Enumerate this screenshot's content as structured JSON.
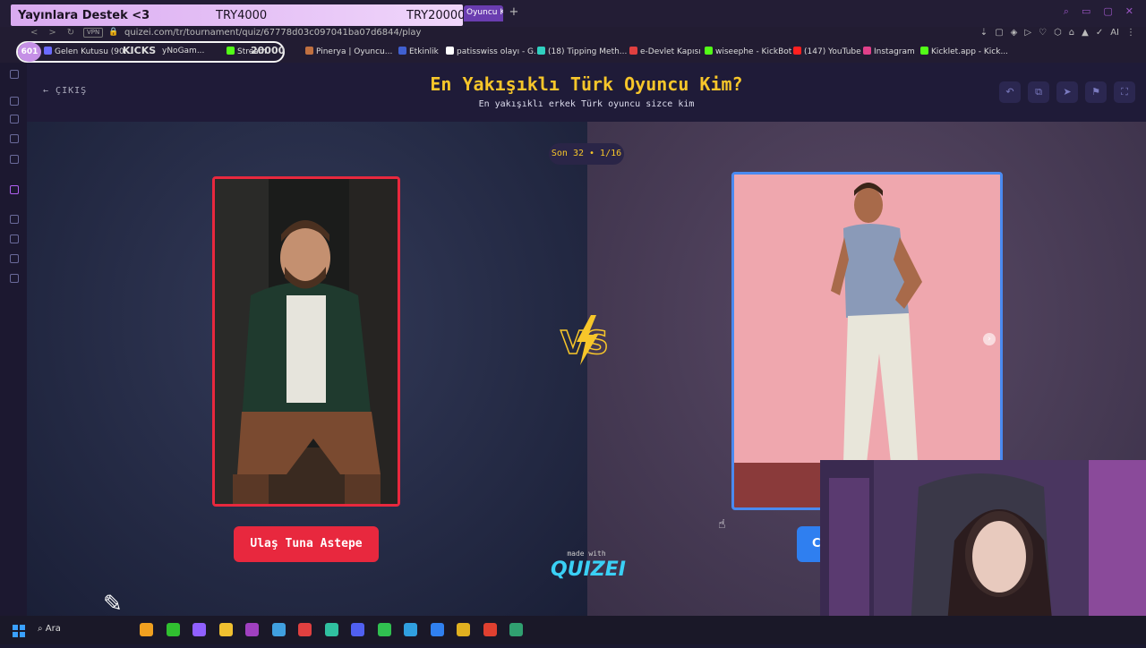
{
  "overlay": {
    "left": "Yayınlara Destek <3",
    "mid": "TRY4000",
    "right": "TRY20000"
  },
  "browser": {
    "active_tab": "Oyuncu K",
    "new_tab": "+",
    "window_controls": [
      "⌕",
      "▭",
      "▢",
      "✕"
    ],
    "url": "quizei.com/tr/tournament/quiz/67778d03c097041ba07d6844/play",
    "vpn": "VPN",
    "lock": "🔒",
    "nav": [
      "<",
      ">",
      "↻"
    ],
    "extensions": [
      "⇣",
      "▢",
      "◈",
      "▷",
      "♡",
      "⬡",
      "⌂",
      "▲",
      "✓",
      "AI",
      "⋮"
    ],
    "bookmarks": [
      {
        "label": "Gelen Kutusu (90...",
        "color": "#6b6bff"
      },
      {
        "label": "KICKS",
        "color": "#53fc18"
      },
      {
        "label": "yNoGam...",
        "color": "#53fc18"
      },
      {
        "label": "Stream",
        "color": "#53fc18"
      },
      {
        "label": "20000",
        "color": "#ffffff"
      },
      {
        "label": "Pinerya | Oyuncu...",
        "color": "#c07040"
      },
      {
        "label": "Etkinlik",
        "color": "#4060d0"
      },
      {
        "label": "patisswiss olayı - G...",
        "color": "#ffffff"
      },
      {
        "label": "(18) Tipping Meth...",
        "color": "#30d0c0"
      },
      {
        "label": "e-Devlet Kapısı",
        "color": "#e04040"
      },
      {
        "label": "wiseephe - KickBot",
        "color": "#53fc18"
      },
      {
        "label": "(147) YouTube",
        "color": "#ff2020"
      },
      {
        "label": "Instagram",
        "color": "#e0408a"
      },
      {
        "label": "Kicklet.app - Kick...",
        "color": "#53fc18"
      }
    ],
    "badge": "601"
  },
  "app": {
    "exit_label": "ÇIKIŞ",
    "title": "En Yakışıklı Türk Oyuncu Kim?",
    "subtitle": "En yakışıklı erkek Türk oyuncu sizce kim",
    "round_label": "Son 32 • 1/16",
    "left_name": "Ulaş Tuna Astepe",
    "right_name": "C",
    "vs": "VS",
    "made_with": "made with",
    "logo": "QUIZEI",
    "header_icons": [
      "undo-icon",
      "share-icon",
      "send-icon",
      "flag-icon",
      "fullscreen-icon"
    ],
    "header_glyphs": [
      "↶",
      "⧉",
      "➤",
      "⚑",
      "⛶"
    ]
  },
  "taskbar": {
    "search": "Ara",
    "apps": [
      "#f0a020",
      "#30c030",
      "#9060ff",
      "#f0c030",
      "#a040c0",
      "#40a0e0",
      "#e04040",
      "#30c0a0",
      "#5060f0",
      "#30c050",
      "#30a0e0",
      "#3080f0",
      "#e0b020",
      "#e04030",
      "#30a070"
    ]
  },
  "colors": {
    "accent_yellow": "#f7c62a",
    "left_red": "#e8283e",
    "right_blue": "#4a8af0",
    "logo_cyan": "#3ad0f5"
  }
}
